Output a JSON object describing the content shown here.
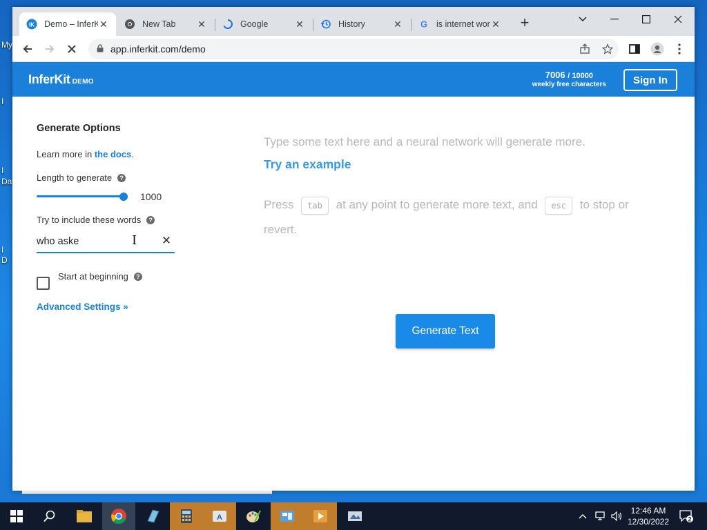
{
  "desktop": {
    "fragments": [
      "My",
      "I",
      "I",
      "Da",
      "I",
      "D"
    ]
  },
  "browser": {
    "tabs": [
      {
        "title": "Demo – InferKit",
        "icon": "inferkit-icon"
      },
      {
        "title": "New Tab",
        "icon": "chrome-icon"
      },
      {
        "title": "Google",
        "icon": "loading-spinner-icon"
      },
      {
        "title": "History",
        "icon": "history-icon"
      },
      {
        "title": "is internet working",
        "icon": "google-icon"
      }
    ],
    "url": "app.inferkit.com/demo"
  },
  "header": {
    "logo": "InferKit",
    "logo_badge": "DEMO",
    "quota_used": "7006",
    "quota_total": "/ 10000",
    "quota_caption": "weekly free characters",
    "sign_in": "Sign In"
  },
  "sidebar": {
    "title": "Generate Options",
    "learn_prefix": "Learn more in ",
    "learn_link": "the docs",
    "learn_suffix": ".",
    "length_label": "Length to generate",
    "length_value": "1000",
    "length_fraction": 1.0,
    "words_label": "Try to include these words",
    "words_value": "who aske",
    "start_label": "Start at beginning",
    "start_checked": false,
    "advanced": "Advanced Settings »"
  },
  "editor": {
    "prompt": "Type some text here and a neural network will generate more.",
    "try_example": "Try an example",
    "hint_press": "Press",
    "hint_tab": "tab",
    "hint_mid": "at any point to generate more text, and",
    "hint_esc": "esc",
    "hint_end": "to stop or revert."
  },
  "generate_button": "Generate Text",
  "taskbar": {
    "apps": [
      "start-icon",
      "search-icon",
      "file-explorer-icon",
      "chrome-icon",
      "app-icon",
      "calculator-icon",
      "app-icon",
      "paint-icon",
      "app-icon",
      "media-icon",
      "app-icon"
    ],
    "time": "12:46 AM",
    "date": "12/30/2022",
    "notifications": "2"
  },
  "colors": {
    "brand": "#1a80d9",
    "button": "#1a8ae8"
  }
}
